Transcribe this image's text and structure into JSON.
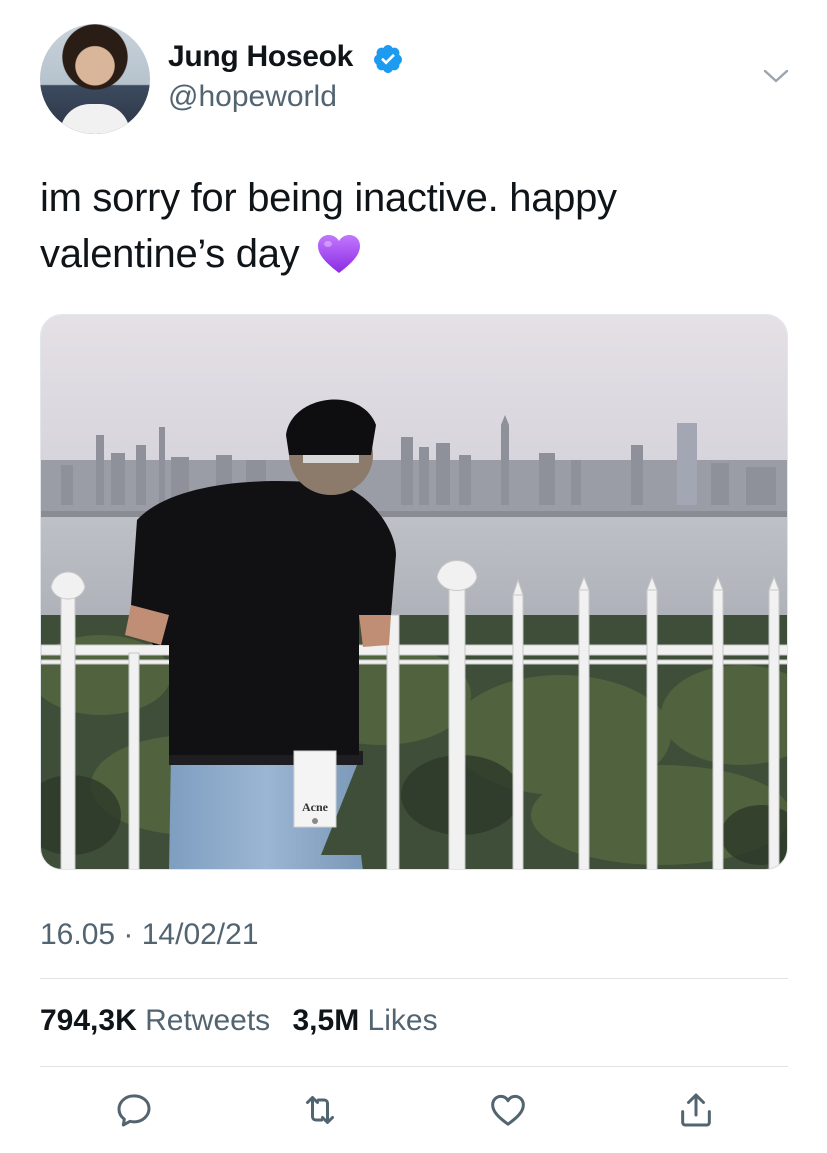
{
  "author": {
    "display_name": "Jung Hoseok",
    "handle": "@hopeworld",
    "verified": true,
    "verified_color": "#1d9bf0"
  },
  "tweet": {
    "text": "im sorry for being inactive. happy valentine’s day",
    "emoji": "purple-heart",
    "emoji_color": "#a046e8",
    "timestamp": "16.05 · 14/02/21"
  },
  "stats": {
    "retweets_count": "794,3K",
    "retweets_label": "Retweets",
    "likes_count": "3,5M",
    "likes_label": "Likes"
  },
  "media": {
    "logo_text": "Acne"
  },
  "actions": [
    "reply-icon",
    "retweet-icon",
    "like-icon",
    "share-icon"
  ],
  "colors": {
    "text_primary": "#0f1419",
    "text_secondary": "#536471",
    "divider": "#dfe3e6"
  }
}
